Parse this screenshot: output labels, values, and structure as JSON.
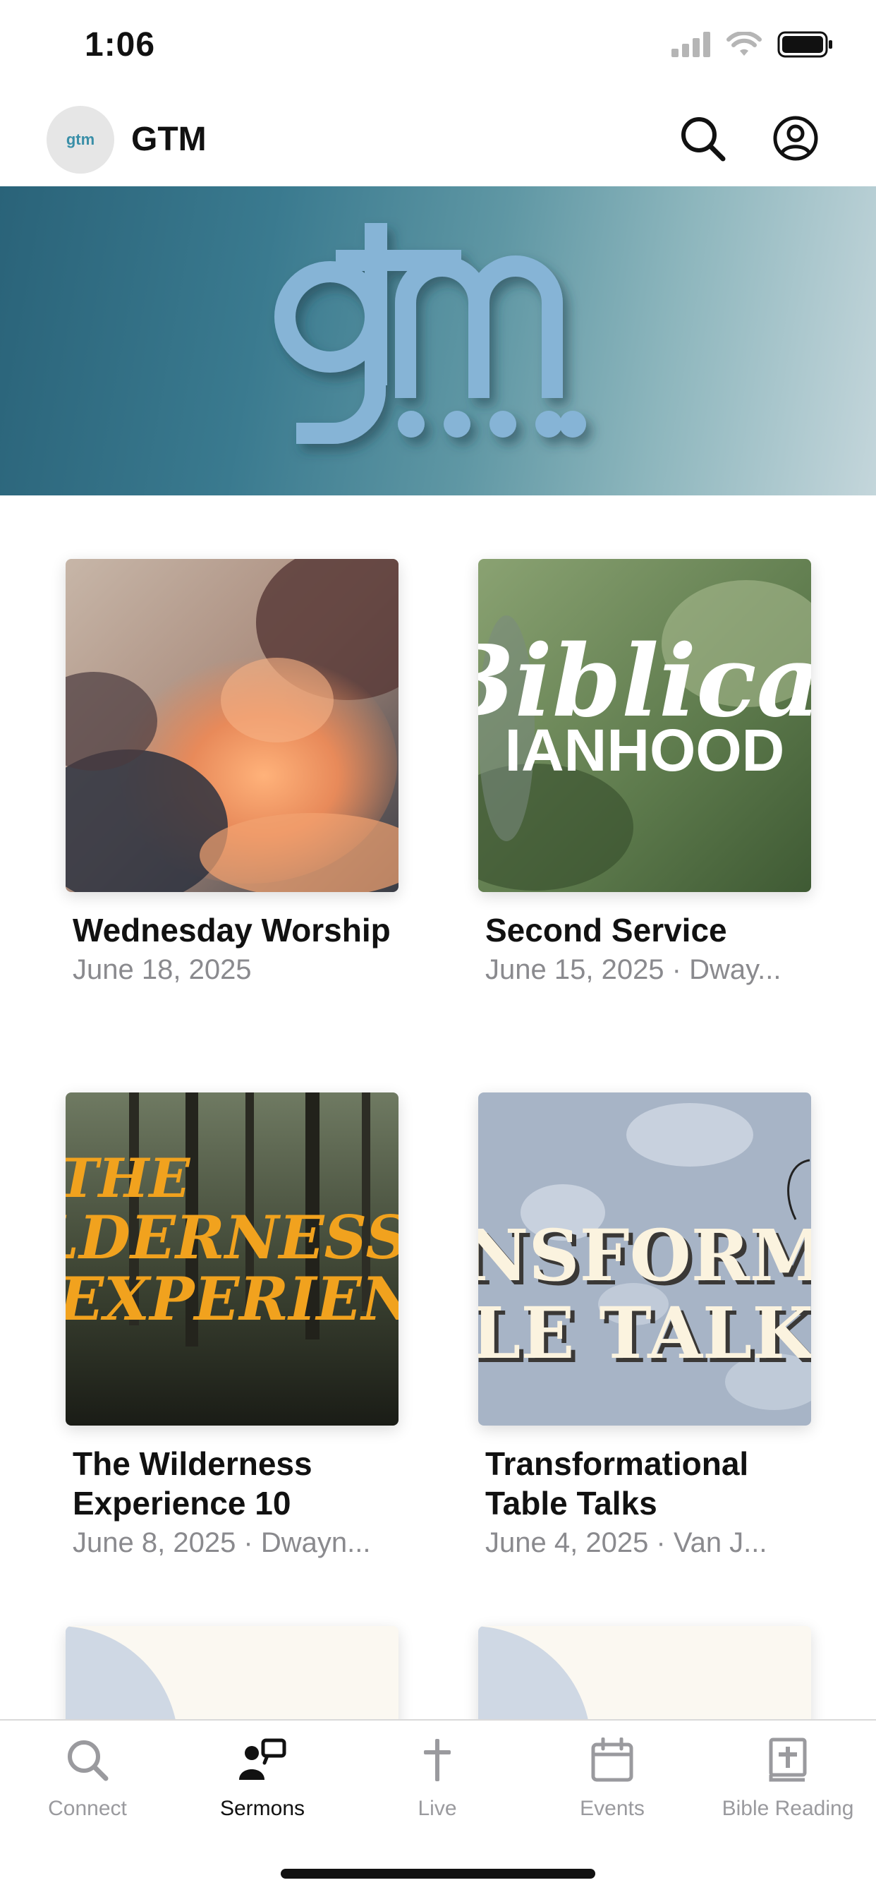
{
  "status_bar": {
    "time": "1:06"
  },
  "header": {
    "avatar_text": "gtm",
    "title": "GTM"
  },
  "hero": {
    "logo_text": "gtm"
  },
  "cards": [
    {
      "title": "Wednesday Worship",
      "meta": "June 18, 2025"
    },
    {
      "title": "Second Service",
      "meta": "June 15, 2025 · Dway...",
      "art_line1": "Biblical",
      "art_line2": "IANHOOD"
    },
    {
      "title": "The Wilderness Experience 10",
      "meta": "June 8, 2025 · Dwayn...",
      "art_line1": "THE",
      "art_line2": "LDERNESS",
      "art_line3": "EXPERIEN"
    },
    {
      "title": "Transformational Table Talks",
      "meta": "June 4, 2025 · Van J...",
      "art_line1": "NSFORMATION",
      "art_line2": "LE TALKS"
    }
  ],
  "tabs": [
    {
      "label": "Connect",
      "icon": "search-icon"
    },
    {
      "label": "Sermons",
      "icon": "sermons-icon"
    },
    {
      "label": "Live",
      "icon": "cross-icon"
    },
    {
      "label": "Events",
      "icon": "calendar-icon"
    },
    {
      "label": "Bible Reading",
      "icon": "bible-icon"
    }
  ],
  "colors": {
    "active_tab": "#111111",
    "inactive_tab": "#9a9a9e",
    "meta_text": "#8a8a8e",
    "hero_logo": "#86b4d6"
  }
}
